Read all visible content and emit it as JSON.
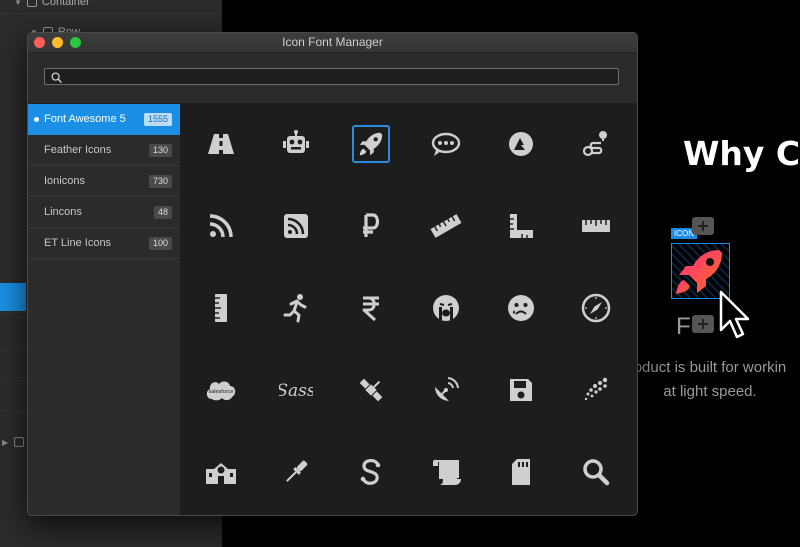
{
  "window": {
    "title": "Icon Font Manager"
  },
  "search": {
    "value": "",
    "placeholder": ""
  },
  "sidebar": {
    "items": [
      {
        "label": "Font Awesome 5",
        "count": "1555",
        "active": true
      },
      {
        "label": "Feather Icons",
        "count": "130"
      },
      {
        "label": "Ionicons",
        "count": "730"
      },
      {
        "label": "Lincons",
        "count": "48"
      },
      {
        "label": "ET Line Icons",
        "count": "100"
      }
    ]
  },
  "grid": {
    "selected_icon": "rocket-icon",
    "icons": [
      "road-icon",
      "robot-icon",
      "rocket-icon",
      "rocketchat-icon",
      "rockrms-icon",
      "route-icon",
      "rss-icon",
      "rss-square-icon",
      "ruble-sign-icon",
      "ruler-icon",
      "ruler-combined-icon",
      "ruler-horizontal-icon",
      "ruler-vertical-icon",
      "running-icon",
      "rupee-sign-icon",
      "sad-cry-icon",
      "sad-tear-icon",
      "safari-icon",
      "salesforce-icon",
      "sass-icon",
      "satellite-icon",
      "satellite-dish-icon",
      "save-icon",
      "schlix-icon",
      "school-icon",
      "screwdriver-icon",
      "scribd-icon",
      "scroll-icon",
      "sd-card-icon",
      "search-icon"
    ],
    "salesforce_text": "salesforce",
    "sass_text": "Sass"
  },
  "editor": {
    "tree_container": "Container",
    "tree_row": "Row"
  },
  "canvas": {
    "heading": "Why C",
    "icon_tag": "ICON",
    "label": "F",
    "paragraph_line1": "oduct is built for workin",
    "paragraph_line2": "at light speed.",
    "brand_gradient": [
      "#ff3d7a",
      "#ff6a2b"
    ]
  },
  "colors": {
    "accent": "#1a8fe3"
  }
}
